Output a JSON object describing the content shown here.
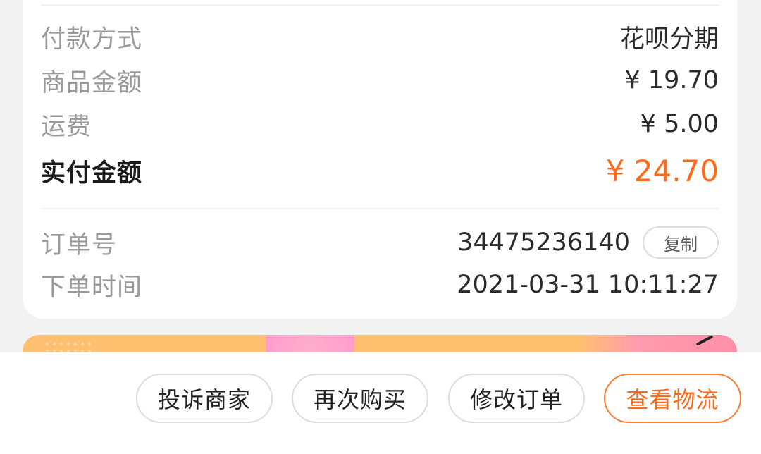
{
  "order": {
    "payment_method": {
      "label": "付款方式",
      "value": "花呗分期"
    },
    "goods_amount": {
      "label": "商品金额",
      "value": "¥ 19.70"
    },
    "shipping_fee": {
      "label": "运费",
      "value": "¥ 5.00"
    },
    "actual_paid": {
      "label": "实付金额",
      "value": "¥ 24.70"
    },
    "order_number": {
      "label": "订单号",
      "value": "34475236140",
      "copy_label": "复制"
    },
    "order_time": {
      "label": "下单时间",
      "value": "2021-03-31 10:11:27"
    }
  },
  "actions": {
    "complain": "投诉商家",
    "rebuy": "再次购买",
    "modify": "修改订单",
    "logistics": "查看物流"
  },
  "colors": {
    "accent": "#ff6a1a",
    "label_gray": "#9a9a9a",
    "background": "#f2f2f2"
  }
}
